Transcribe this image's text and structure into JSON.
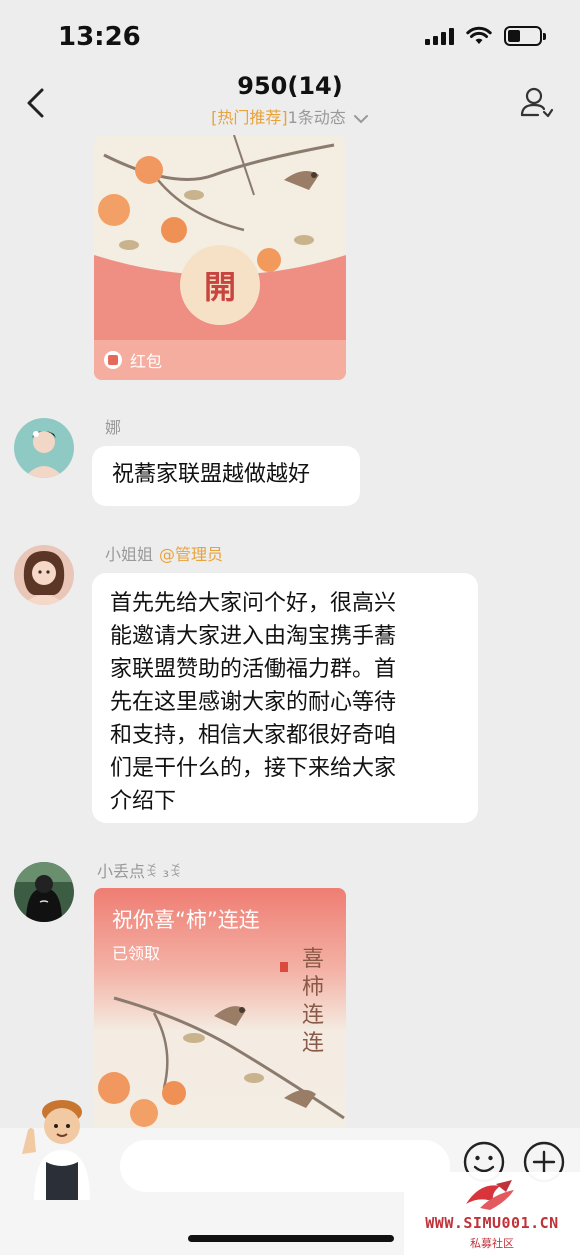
{
  "status_bar": {
    "time": "13:26"
  },
  "header": {
    "title": "950(14)",
    "tag": "[热门推荐]",
    "updates": "1条动态"
  },
  "messages": [
    {
      "type": "red_packet",
      "label": "红包",
      "seal": "開"
    },
    {
      "type": "text",
      "sender": "娜",
      "text": "祝蕎家联盟越做越好"
    },
    {
      "type": "text",
      "sender": "小姐姐",
      "badge": "@管理员",
      "lines": [
        "首先先给大家问个好，很高兴",
        "能邀请大家进入由淘宝携手蕎",
        "家联盟赞助的活働福力群。首",
        "先在这里感谢大家的耐心等待",
        "和支持，相信大家都很好奇咱",
        "们是干什么的，接下来给大家",
        "介绍下"
      ]
    },
    {
      "type": "red_packet",
      "sender": "小丢点ꉂ ₃ꉂ",
      "title": "祝你喜“柿”连连",
      "status": "已领取",
      "calligraphy": "喜柿连连"
    }
  ],
  "input": {
    "placeholder": ""
  },
  "watermark": {
    "url": "WWW.SIMU001.CN",
    "subtitle": "私募社区"
  },
  "colors": {
    "accent": "#e8a33c",
    "packet_pink": "#f2998a",
    "watermark_red": "#c0333a"
  }
}
